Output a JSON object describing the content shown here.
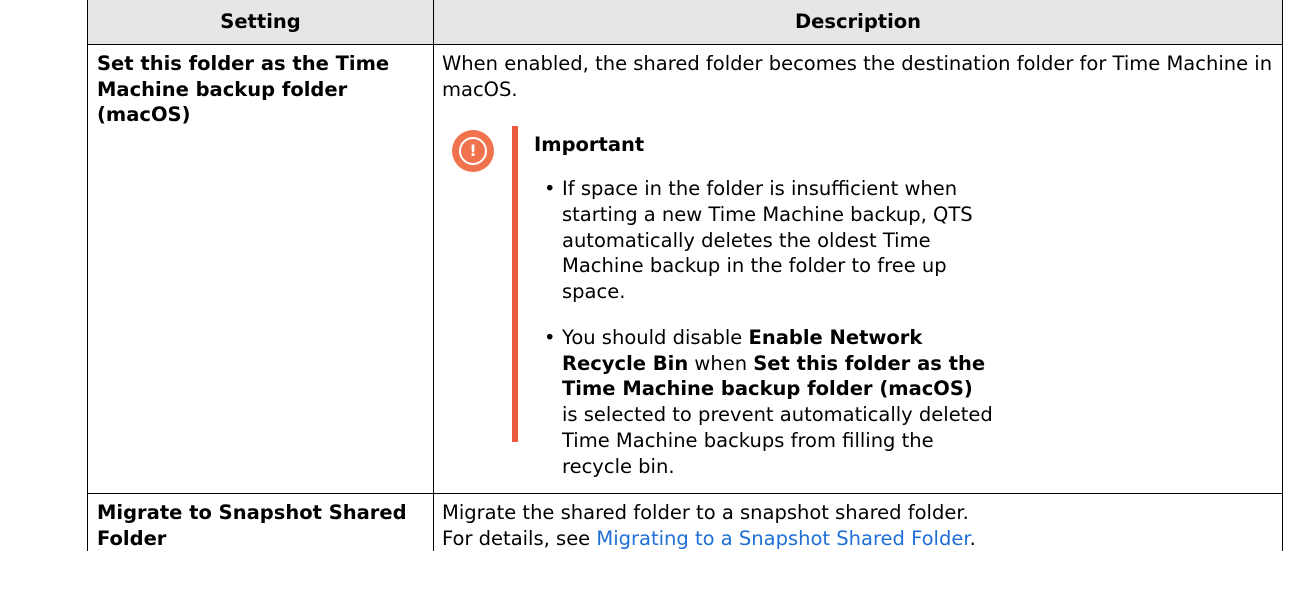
{
  "table": {
    "header": {
      "setting": "Setting",
      "description": "Description"
    },
    "rows": [
      {
        "setting": "Set this folder as the Time Machine backup folder (macOS)",
        "description": "When enabled, the shared folder becomes the destination folder for Time Machine in macOS.",
        "important": {
          "title": "Important",
          "icon": "exclamation-circle-icon",
          "items": [
            {
              "text": "If space in the folder is insufficient when starting a new Time Machine backup, QTS automatically deletes the oldest Time Machine backup in the folder to free up space."
            },
            {
              "part1": "You should disable ",
              "bold1": "Enable Network Recycle Bin",
              "part2": " when ",
              "bold2": "Set this folder as the Time Machine backup folder (macOS)",
              "part3": " is selected to prevent automatically deleted Time Machine backups from filling the recycle bin."
            }
          ]
        }
      },
      {
        "setting": "Migrate to Snapshot Shared Folder",
        "description_line1": "Migrate the shared folder to a snapshot shared folder.",
        "description_prefix": "For details, see ",
        "description_link": "Migrating to a Snapshot Shared Folder",
        "description_suffix": "."
      }
    ]
  },
  "colors": {
    "header_bg": "#e6e6e6",
    "important_accent": "#e95b3c",
    "icon_fill": "#f0734d",
    "link": "#1f6fd6"
  }
}
